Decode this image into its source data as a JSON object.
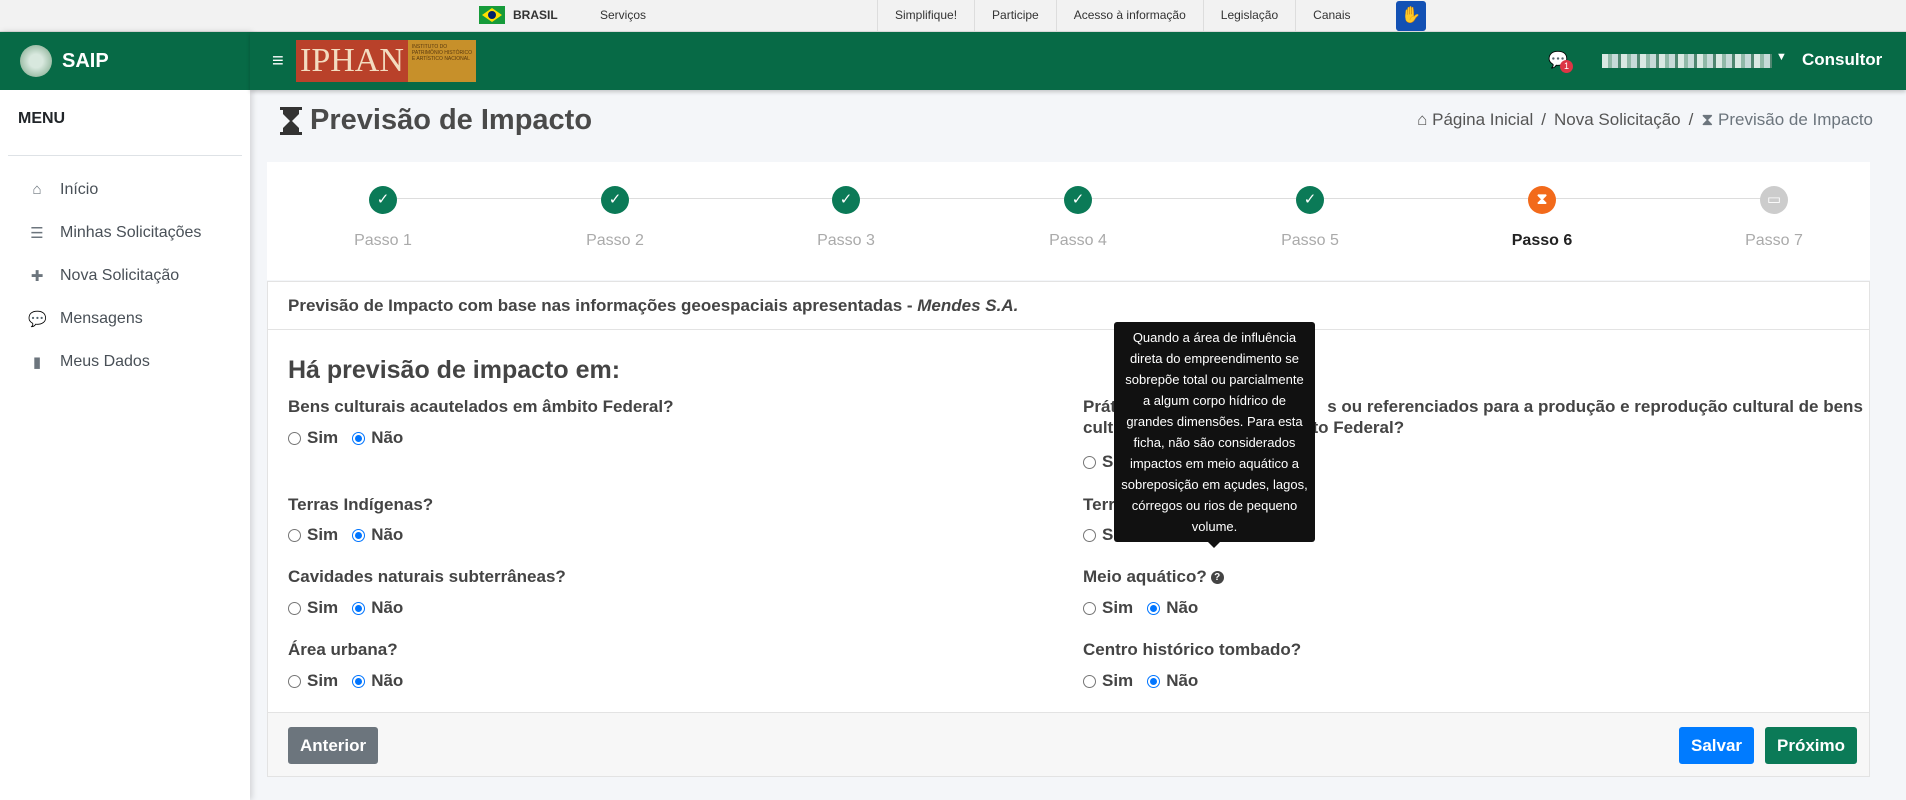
{
  "govbar": {
    "brasil": "BRASIL",
    "servicos": "Serviços",
    "links": [
      "Simplifique!",
      "Participe",
      "Acesso à informação",
      "Legislação",
      "Canais"
    ]
  },
  "sidebar": {
    "brand": "SAIP",
    "menu_title": "MENU",
    "items": [
      {
        "label": "Início",
        "icon": "home-icon"
      },
      {
        "label": "Minhas Solicitações",
        "icon": "list-icon"
      },
      {
        "label": "Nova Solicitação",
        "icon": "plus-icon"
      },
      {
        "label": "Mensagens",
        "icon": "comments-icon"
      },
      {
        "label": "Meus Dados",
        "icon": "file-icon"
      }
    ]
  },
  "topnav": {
    "logo_text": "IPHAN",
    "logo_subtext": "INSTITUTO DO PATRIMÔNIO HISTÓRICO E ARTÍSTICO NACIONAL",
    "messages_badge": "1",
    "role": "Consultor"
  },
  "page": {
    "title": "Previsão de Impacto",
    "breadcrumb": {
      "home": "Página Inicial",
      "nova": "Nova Solicitação",
      "current": "Previsão de Impacto"
    }
  },
  "stepper": {
    "steps": [
      {
        "label": "Passo 1",
        "status": "done"
      },
      {
        "label": "Passo 2",
        "status": "done"
      },
      {
        "label": "Passo 3",
        "status": "done"
      },
      {
        "label": "Passo 4",
        "status": "done"
      },
      {
        "label": "Passo 5",
        "status": "done"
      },
      {
        "label": "Passo 6",
        "status": "current"
      },
      {
        "label": "Passo 7",
        "status": "todo"
      }
    ]
  },
  "form": {
    "header_text": "Previsão de Impacto com base nas informações geoespaciais apresentadas - ",
    "header_company": "Mendes S.A.",
    "heading": "Há previsão de impacto em:",
    "sim": "Sim",
    "nao": "Não",
    "questions": {
      "bens": "Bens culturais acautelados em âmbito Federal?",
      "praticas_a": "Prátic",
      "praticas_b": "s ou referenciados para a produção e reprodução cultural de bens",
      "praticas_c": "cultur",
      "praticas_d": "mbito Federal?",
      "terras_indigenas": "Terras Indígenas?",
      "terras_r": "Terra",
      "cavidades": "Cavidades naturais subterrâneas?",
      "meio_aquatico": "Meio aquático?",
      "area_urbana": "Área urbana?",
      "centro_historico": "Centro histórico tombado?"
    },
    "tooltip": "Quando a área de influência direta do empreendimento se sobrepõe total ou parcialmente a algum corpo hídrico de grandes dimensões. Para esta ficha, não são considerados impactos em meio aquático a sobreposição em açudes, lagos, córregos ou rios de pequeno volume."
  },
  "footer": {
    "prev": "Anterior",
    "save": "Salvar",
    "next": "Próximo"
  },
  "colors": {
    "brand_green": "#076a46",
    "step_done": "#0b7a57",
    "step_current": "#f26a1b",
    "primary": "#007bff"
  }
}
